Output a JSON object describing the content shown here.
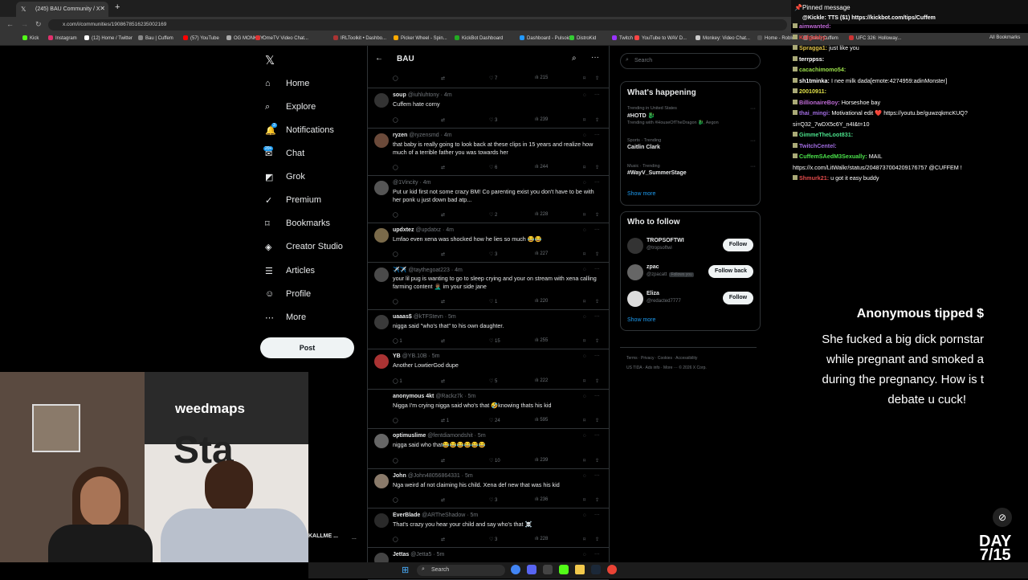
{
  "browser": {
    "tabs": [
      {
        "label": "(245) BAU Community / X",
        "active": true
      }
    ],
    "new_tab": "+",
    "url": "x.com/i/communities/1908678516235002169",
    "bookmarks": [
      "Kick",
      "Instagram",
      "(12) Home / Twitter",
      "Bau | Cuffem",
      "(57) YouTube",
      "OG MONKEY",
      "OmeTV Video Chat...",
      "IRLToolkit • Dashbo...",
      "Picker Wheel - Spin...",
      "KickBot Dashboard",
      "Dashboard - Pulsoid",
      "DistroKid",
      "Twitch",
      "YouTube to WAV D...",
      "Monkey: Video Chat...",
      "Home - Roblox",
      "Bau | Cuffem",
      "UFC 326: Holloway..."
    ],
    "all_bookmarks": "All Bookmarks"
  },
  "sidebar": {
    "items": [
      {
        "label": "Home",
        "icon": "home-icon"
      },
      {
        "label": "Explore",
        "icon": "search-icon"
      },
      {
        "label": "Notifications",
        "icon": "bell-icon"
      },
      {
        "label": "Chat",
        "icon": "chat-icon"
      },
      {
        "label": "Grok",
        "icon": "grok-icon"
      },
      {
        "label": "Premium",
        "icon": "premium-icon"
      },
      {
        "label": "Bookmarks",
        "icon": "bookmark-icon"
      },
      {
        "label": "Creator Studio",
        "icon": "creator-icon"
      },
      {
        "label": "Articles",
        "icon": "articles-icon"
      },
      {
        "label": "Profile",
        "icon": "profile-icon"
      },
      {
        "label": "More",
        "icon": "more-icon"
      }
    ],
    "notif_badge": "3",
    "chat_badge": "20+",
    "post_label": "Post",
    "account_name": "KALLME ...",
    "account_more": "..."
  },
  "feed": {
    "title": "BAU",
    "top_counts": {
      "likes": "7",
      "views": "215"
    },
    "posts": [
      {
        "name": "soup",
        "handle": "@iuhluhtony · 4m",
        "text": "Cuffem hate corny",
        "replies": "",
        "likes": "3",
        "views": "239",
        "avatar": "#333"
      },
      {
        "name": "ryzen",
        "handle": "@ryzensmd · 4m",
        "text": "that baby is really going to look back at these clips in 15 years and realize how much of a terrible father you was towards her",
        "replies": "",
        "likes": "6",
        "views": "244",
        "avatar": "#6b4a3a"
      },
      {
        "name": "",
        "handle": "@1Vincity · 4m",
        "text": "Put ur kid first not some crazy BM! Co parenting exist you don't have to be with her ponk u just down bad atp...",
        "replies": "",
        "likes": "2",
        "views": "228",
        "avatar": "#555"
      },
      {
        "name": "updxtez",
        "handle": "@updatxz · 4m",
        "text": "Lmfao even xena was shocked how he lies so much 😂😂",
        "replies": "",
        "likes": "3",
        "views": "227",
        "avatar": "#7a6a4a"
      },
      {
        "name": "✈️✈️",
        "handle": "@taythegoat223 · 4m",
        "text": "your lil pug is  wanting to go to sleep crying and your on stream with xena calling farming content 🤦🏾‍♂️ im your side jane",
        "replies": "",
        "likes": "1",
        "views": "220",
        "avatar": "#4a4a4a"
      },
      {
        "name": "uaaas$",
        "handle": "@kTFStevn · 5m",
        "text": "nigga said \"who's that\" to his own daughter.",
        "replies": "1",
        "likes": "15",
        "views": "255",
        "avatar": "#3a3a3a"
      },
      {
        "name": "YB",
        "handle": "@YB.10B · 5m",
        "text": "Another LowtierGod dupe",
        "replies": "1",
        "likes": "5",
        "views": "222",
        "avatar": "#a33"
      },
      {
        "name": "anonymous 4kt",
        "handle": "@Rackz7k · 5m",
        "text": "Nigga I'm crying nigga said who's that 🤣knowing thats his kid",
        "replies": "",
        "likes": "24",
        "views": "595",
        "avatar": "#000"
      },
      {
        "name": "optimuslime",
        "handle": "@fentdiamondshit · 5m",
        "text": "nigga said who that😂😂😂😂😂😂",
        "replies": "",
        "likes": "10",
        "views": "239",
        "avatar": "#666"
      },
      {
        "name": "John",
        "handle": "@John48056864331 · 5m",
        "text": "Nga weird af not claiming his child. Xena def new that was his kid",
        "replies": "",
        "likes": "3",
        "views": "236",
        "avatar": "#8a7a6a"
      },
      {
        "name": "EverBlade",
        "handle": "@ARTheShadow · 5m",
        "text": "That's crazy you hear your child and say who's that ☠️",
        "replies": "",
        "likes": "3",
        "views": "228",
        "avatar": "#2a2a2a"
      },
      {
        "name": "Jettas",
        "handle": "@Jetta5 · 5m",
        "text": "",
        "replies": "",
        "likes": "",
        "views": "",
        "avatar": "#444"
      }
    ],
    "retweet_counts": {
      "anonymous": "1"
    }
  },
  "right": {
    "search_placeholder": "Search",
    "happening_title": "What's happening",
    "trends": [
      {
        "meta": "Trending in United States",
        "name": "#HOTD 🐉",
        "sub": "Trending with #HouseOfTheDragon 🐉, Aegon"
      },
      {
        "meta": "Sports · Trending",
        "name": "Caitlin Clark",
        "sub": ""
      },
      {
        "meta": "Music · Trending",
        "name": "#WayV_SummerStage",
        "sub": ""
      }
    ],
    "show_more": "Show more",
    "follow_title": "Who to follow",
    "follows": [
      {
        "name": "TROPSOFTWI",
        "handle": "@tropsoftwi",
        "button": "Follow",
        "follows_you": ""
      },
      {
        "name": "zpac",
        "handle": "@zpacatt",
        "button": "Follow back",
        "follows_you": "Follows you"
      },
      {
        "name": "Eliza",
        "handle": "@redacted7777",
        "button": "Follow",
        "follows_you": ""
      }
    ],
    "show_more2": "Show more",
    "footer1": "Terms · Privacy · Cookies · Accessibility",
    "footer2": "US TIDA · Ads info · More ··· © 2026 X Corp."
  },
  "chat": {
    "pinned_label": "Pinned message",
    "pinned_text": "@Kickle: TTS ($1) https://kickbot.com/tips/Cuffem",
    "lines": [
      {
        "user": "aimwanted:",
        "text": "",
        "color": "#c06bd6"
      },
      {
        "user": "Kafgabby:",
        "text": "",
        "color": "#e04040"
      },
      {
        "user": "Spragga1:",
        "text": "just like you",
        "color": "#e0c34a"
      },
      {
        "user": "terrppss:",
        "text": "",
        "color": "#fff"
      },
      {
        "user": "cacachimomo54:",
        "text": "",
        "color": "#9be04a"
      },
      {
        "user": "sh1tminka:",
        "text": "I nee milk dada[emote:4274959:adinMonster]",
        "color": "#fff"
      },
      {
        "user": "20010911:",
        "text": "",
        "color": "#e0e04a"
      },
      {
        "user": "BillionaireBoy:",
        "text": "Horseshoe bay",
        "color": "#c06bd6"
      },
      {
        "user": "thai_mingi:",
        "text": "Motivational edit ❤️ https://youtu.be/guwzqkmcKUQ?",
        "color": "#a06be0"
      },
      {
        "user": "",
        "text": "si=Q32_7wDX5c6Y_n4I&t=10",
        "color": "#fff"
      },
      {
        "user": "GimmeTheLoot831:",
        "text": "",
        "color": "#4ae08a"
      },
      {
        "user": "TwitchCentel:",
        "text": "",
        "color": "#a06be0"
      },
      {
        "user": "CuffemSAedM3Sexually:",
        "text": "MAIL",
        "color": "#4ae04a"
      },
      {
        "user": "",
        "text": "https://x.com/LitWalkr/status/2048737004209176757 @CUFFEM !",
        "color": "#fff"
      },
      {
        "user": "Shmurk21:",
        "text": "u got it easy buddy",
        "color": "#e04a4a"
      }
    ],
    "tip_title": "Anonymous tipped $",
    "tip_lines": [
      "She fucked a big dick pornstar",
      "while pregnant and smoked a",
      "during the pregnancy. How is t",
      "debate u cuck!"
    ]
  },
  "overlay": {
    "day": "DAY",
    "count": "7/15"
  },
  "taskbar": {
    "search": "Search"
  },
  "stream": {
    "sign": "weedmaps",
    "letters": "Sta"
  }
}
